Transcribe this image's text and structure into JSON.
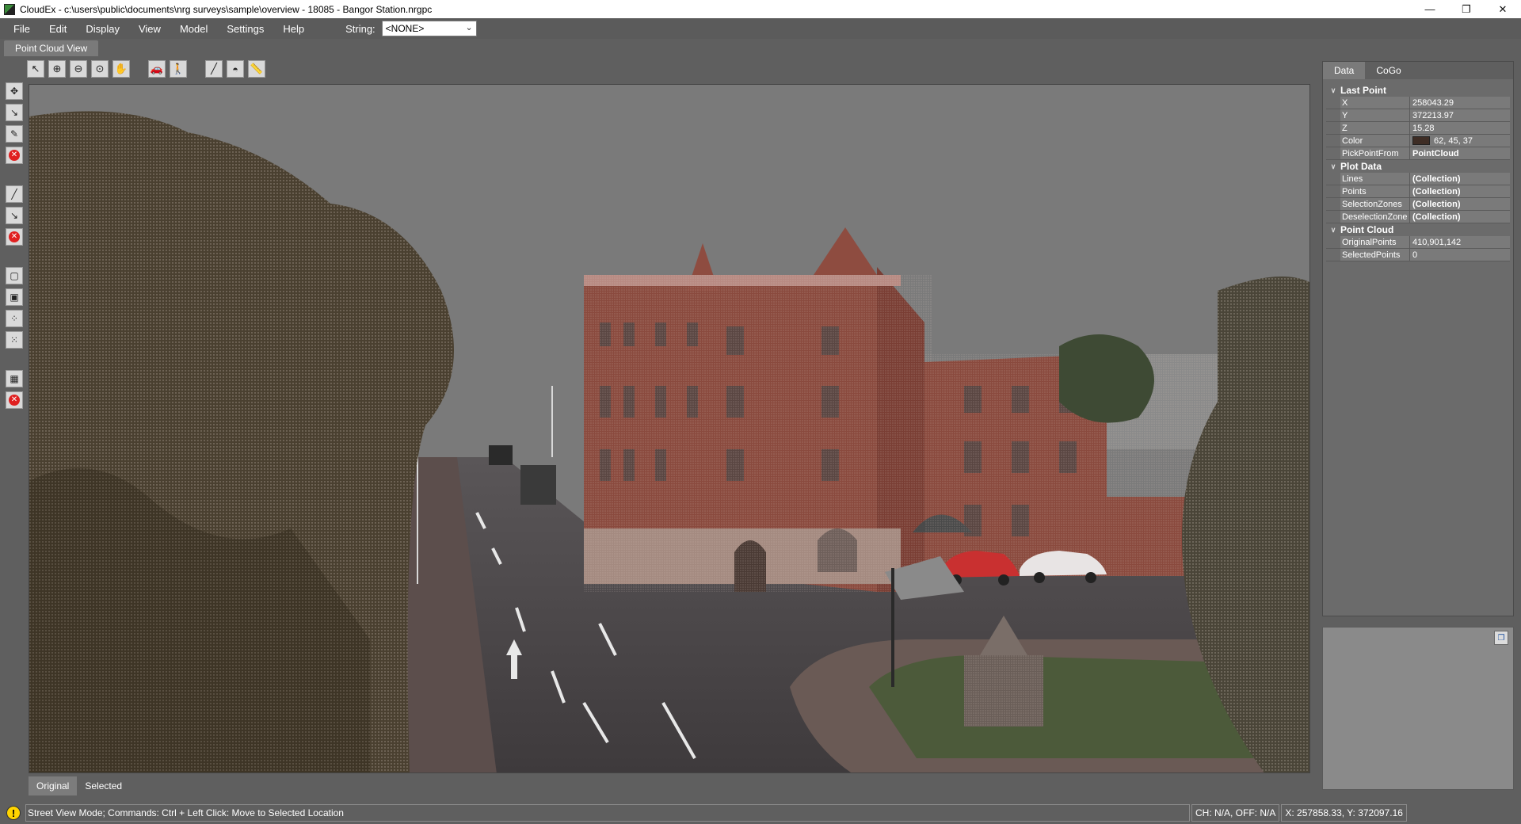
{
  "window": {
    "title": "CloudEx - c:\\users\\public\\documents\\nrg surveys\\sample\\overview - 18085 - Bangor Station.nrgpc",
    "minimize": "—",
    "maximize": "❐",
    "close": "✕"
  },
  "menu": {
    "items": [
      "File",
      "Edit",
      "Display",
      "View",
      "Model",
      "Settings",
      "Help"
    ],
    "string_label": "String:",
    "string_value": "<NONE>"
  },
  "doc_tab": {
    "label": "Point Cloud View"
  },
  "bottom_tabs": [
    "Original",
    "Selected"
  ],
  "right_panel": {
    "tabs": [
      "Data",
      "CoGo"
    ],
    "categories": {
      "last_point": "Last Point",
      "plot_data": "Plot Data",
      "point_cloud": "Point Cloud"
    },
    "last_point": {
      "x_label": "X",
      "x_value": "258043.29",
      "y_label": "Y",
      "y_value": "372213.97",
      "z_label": "Z",
      "z_value": "15.28",
      "color_label": "Color",
      "color_value": "62, 45, 37",
      "color_swatch": "#3e2d25",
      "pick_label": "PickPointFrom",
      "pick_value": "PointCloud"
    },
    "plot_data": {
      "lines_label": "Lines",
      "lines_value": "(Collection)",
      "points_label": "Points",
      "points_value": "(Collection)",
      "selzones_label": "SelectionZones",
      "selzones_value": "(Collection)",
      "deselzones_label": "DeselectionZone",
      "deselzones_value": "(Collection)"
    },
    "point_cloud": {
      "orig_label": "OriginalPoints",
      "orig_value": "410,901,142",
      "sel_label": "SelectedPoints",
      "sel_value": "0"
    }
  },
  "status": {
    "message": "Street View Mode; Commands: Ctrl + Left Click: Move to Selected Location",
    "ch": "CH: N/A, OFF: N/A",
    "coords": "X: 257858.33, Y: 372097.16",
    "icon_glyph": "!"
  },
  "colors": {
    "chrome": "#5f5f5f",
    "sky": "#7a7a7a",
    "brick": "#8a4a3e",
    "tree": "#4a4030"
  }
}
